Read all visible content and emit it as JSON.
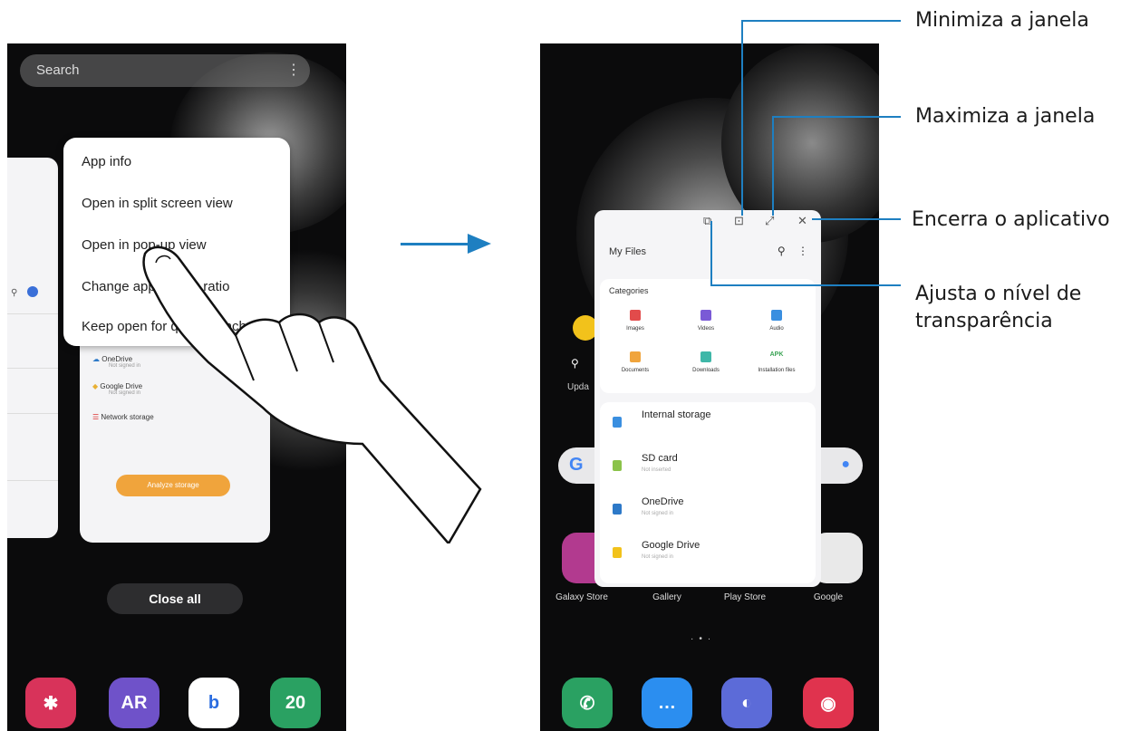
{
  "left_phone": {
    "search_placeholder": "Search",
    "menu_items": [
      "App info",
      "Open in split screen view",
      "Open in pop-up view",
      "Change app aspect ratio",
      "Keep open for quick launch"
    ],
    "mini_list": [
      {
        "name": "OneDrive",
        "sub": "Not signed in"
      },
      {
        "name": "Google Drive",
        "sub": "Not signed in"
      },
      {
        "name": "Network storage",
        "sub": ""
      }
    ],
    "analyze_label": "Analyze storage",
    "close_all": "Close all",
    "dock_ar": "AR",
    "dock_cal": "20"
  },
  "right_phone": {
    "popup_title": "My Files",
    "categories_title": "Categories",
    "categories": [
      "Images",
      "Videos",
      "Audio",
      "Documents",
      "Downloads",
      "Installation files"
    ],
    "apk_label": "APK",
    "storage": [
      {
        "name": "Internal storage",
        "sub": ""
      },
      {
        "name": "SD card",
        "sub": "Not inserted"
      },
      {
        "name": "OneDrive",
        "sub": "Not signed in"
      },
      {
        "name": "Google Drive",
        "sub": "Not signed in"
      }
    ],
    "weather_label": "Upda",
    "apps": [
      "Galaxy Store",
      "Gallery",
      "Play Store",
      "Google"
    ]
  },
  "callouts": {
    "minimize": "Minimiza a janela",
    "maximize": "Maximiza a janela",
    "close": "Encerra o aplicativo",
    "transparency_1": "Ajusta o nível de",
    "transparency_2": "transparência"
  },
  "colors": {
    "accent": "#1e7fc1",
    "analyze": "#f0a43c"
  }
}
